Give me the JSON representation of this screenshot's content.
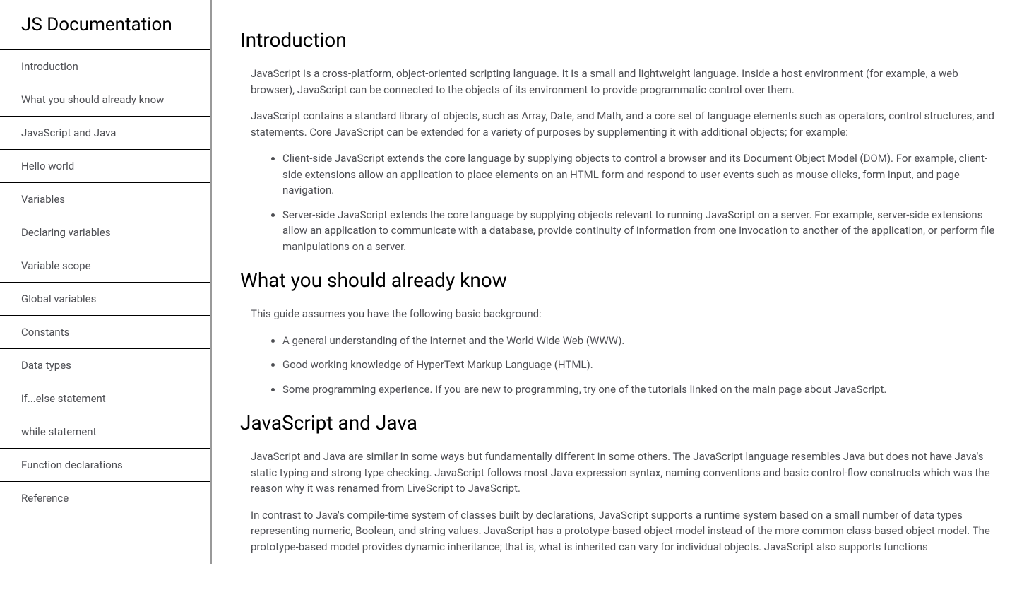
{
  "sidebar": {
    "title": "JS Documentation",
    "items": [
      "Introduction",
      "What you should already know",
      "JavaScript and Java",
      "Hello world",
      "Variables",
      "Declaring variables",
      "Variable scope",
      "Global variables",
      "Constants",
      "Data types",
      "if...else statement",
      "while statement",
      "Function declarations",
      "Reference"
    ]
  },
  "main": {
    "sections": [
      {
        "heading": "Introduction",
        "paragraphs": [
          "JavaScript is a cross-platform, object-oriented scripting language. It is a small and lightweight language. Inside a host environment (for example, a web browser), JavaScript can be connected to the objects of its environment to provide programmatic control over them.",
          "JavaScript contains a standard library of objects, such as Array, Date, and Math, and a core set of language elements such as operators, control structures, and statements. Core JavaScript can be extended for a variety of purposes by supplementing it with additional objects; for example:"
        ],
        "list": [
          "Client-side JavaScript extends the core language by supplying objects to control a browser and its Document Object Model (DOM). For example, client-side extensions allow an application to place elements on an HTML form and respond to user events such as mouse clicks, form input, and page navigation.",
          "Server-side JavaScript extends the core language by supplying objects relevant to running JavaScript on a server. For example, server-side extensions allow an application to communicate with a database, provide continuity of information from one invocation to another of the application, or perform file manipulations on a server."
        ]
      },
      {
        "heading": "What you should already know",
        "paragraphs": [
          "This guide assumes you have the following basic background:"
        ],
        "list": [
          "A general understanding of the Internet and the World Wide Web (WWW).",
          "Good working knowledge of HyperText Markup Language (HTML).",
          "Some programming experience. If you are new to programming, try one of the tutorials linked on the main page about JavaScript."
        ]
      },
      {
        "heading": "JavaScript and Java",
        "paragraphs": [
          "JavaScript and Java are similar in some ways but fundamentally different in some others. The JavaScript language resembles Java but does not have Java's static typing and strong type checking. JavaScript follows most Java expression syntax, naming conventions and basic control-flow constructs which was the reason why it was renamed from LiveScript to JavaScript.",
          "In contrast to Java's compile-time system of classes built by declarations, JavaScript supports a runtime system based on a small number of data types representing numeric, Boolean, and string values. JavaScript has a prototype-based object model instead of the more common class-based object model. The prototype-based model provides dynamic inheritance; that is, what is inherited can vary for individual objects. JavaScript also supports functions"
        ],
        "list": []
      }
    ]
  }
}
